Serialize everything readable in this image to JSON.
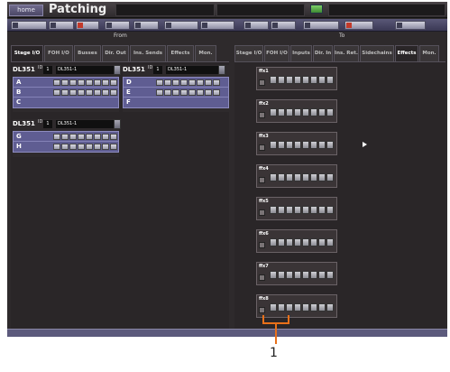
{
  "titlebar": {
    "home_label": "home",
    "title": "Patching"
  },
  "sections": {
    "from_label": "From",
    "to_label": "To"
  },
  "from_tabs": [
    "Stage I/O",
    "FOH I/O",
    "Busses",
    "Dir. Out",
    "Ins. Sends",
    "Effects",
    "Mon."
  ],
  "to_tabs": [
    "Stage I/O",
    "FOH I/O",
    "Inputs",
    "Dir. In",
    "Ins. Ret.",
    "Sidechains",
    "Effects",
    "Mon."
  ],
  "dl_blocks": [
    {
      "name": "DL351",
      "id_label": "ID",
      "id_value": "1",
      "field": "DL351-1",
      "rows": [
        "A",
        "B",
        "C"
      ]
    },
    {
      "name": "DL351",
      "id_label": "ID",
      "id_value": "1",
      "field": "DL351-1",
      "rows": [
        "D",
        "E",
        "F"
      ]
    },
    {
      "name": "DL351",
      "id_label": "ID",
      "id_value": "1",
      "field": "DL351-1",
      "rows": [
        "G",
        "H"
      ]
    }
  ],
  "effects": [
    "ffx1",
    "ffx2",
    "ffx3",
    "ffx4",
    "ffx5",
    "ffx6",
    "ffx7",
    "ffx8"
  ],
  "callout": "1"
}
